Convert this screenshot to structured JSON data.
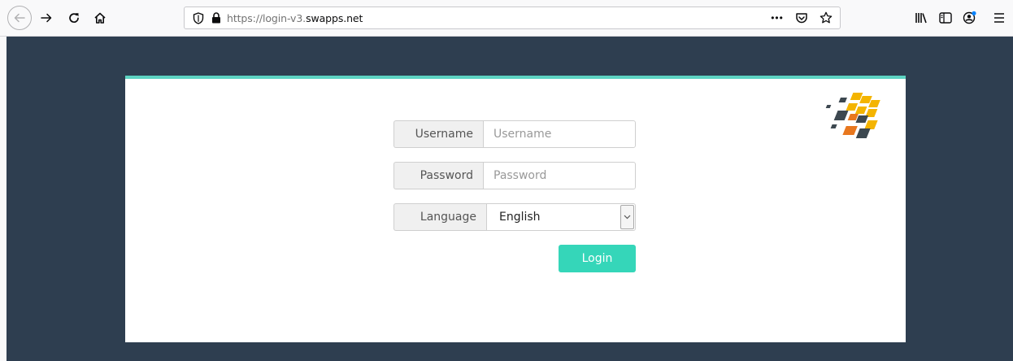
{
  "browser": {
    "url_scheme_path": "https://login-v3.",
    "url_host": "swapps.net",
    "icons": [
      "back-arrow-icon",
      "forward-arrow-icon",
      "reload-icon",
      "home-icon",
      "tracking-shield-icon",
      "lock-icon",
      "more-actions-icon",
      "pocket-icon",
      "bookmark-star-icon",
      "library-icon",
      "sidebar-icon",
      "account-icon",
      "menu-icon"
    ],
    "more_actions_label": "•••"
  },
  "login_form": {
    "username": {
      "label": "Username",
      "placeholder": "Username",
      "value": ""
    },
    "password": {
      "label": "Password",
      "placeholder": "Password",
      "value": ""
    },
    "language": {
      "label": "Language",
      "selected": "English"
    },
    "login_button": "Login"
  },
  "colors": {
    "page_background": "#2e3e50",
    "card_accent": "#5dd3c2",
    "login_button": "#35d6b9",
    "logo_yellow": "#f4b400",
    "logo_orange": "#e8771e",
    "logo_dark": "#3d4850"
  }
}
